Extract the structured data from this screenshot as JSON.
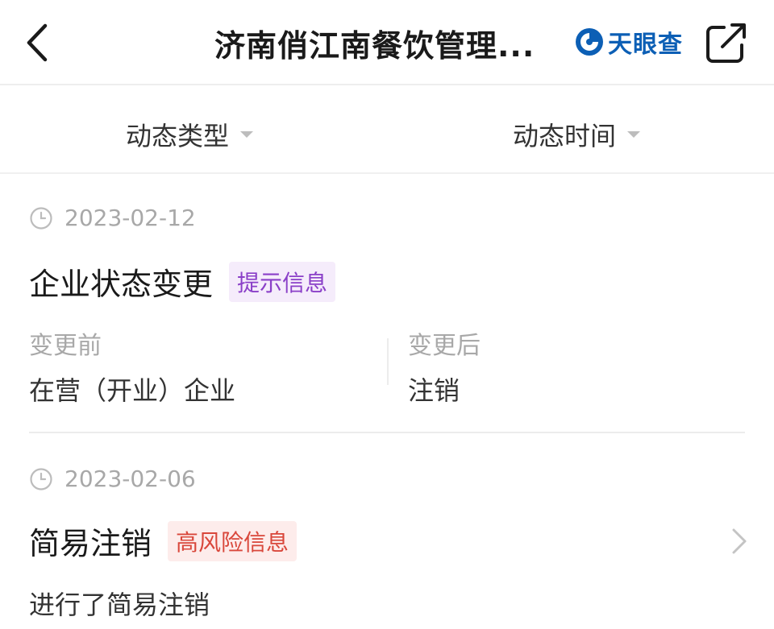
{
  "header": {
    "title": "济南俏江南餐饮管理...",
    "brand_name": "天眼查",
    "brand_color": "#0c5fb5",
    "icons": {
      "back": "back-arrow-icon",
      "share": "share-icon",
      "logo": "tianyancha-logo-icon"
    }
  },
  "filters": {
    "type_label": "动态类型",
    "time_label": "动态时间"
  },
  "events": [
    {
      "date": "2023-02-12",
      "title": "企业状态变更",
      "tag": "提示信息",
      "tag_color": "#8a3fc8",
      "before_label": "变更前",
      "before_value": "在营（开业）企业",
      "after_label": "变更后",
      "after_value": "注销"
    },
    {
      "date": "2023-02-06",
      "title": "简易注销",
      "tag": "高风险信息",
      "tag_color": "#d9473b",
      "description": "进行了简易注销"
    }
  ]
}
